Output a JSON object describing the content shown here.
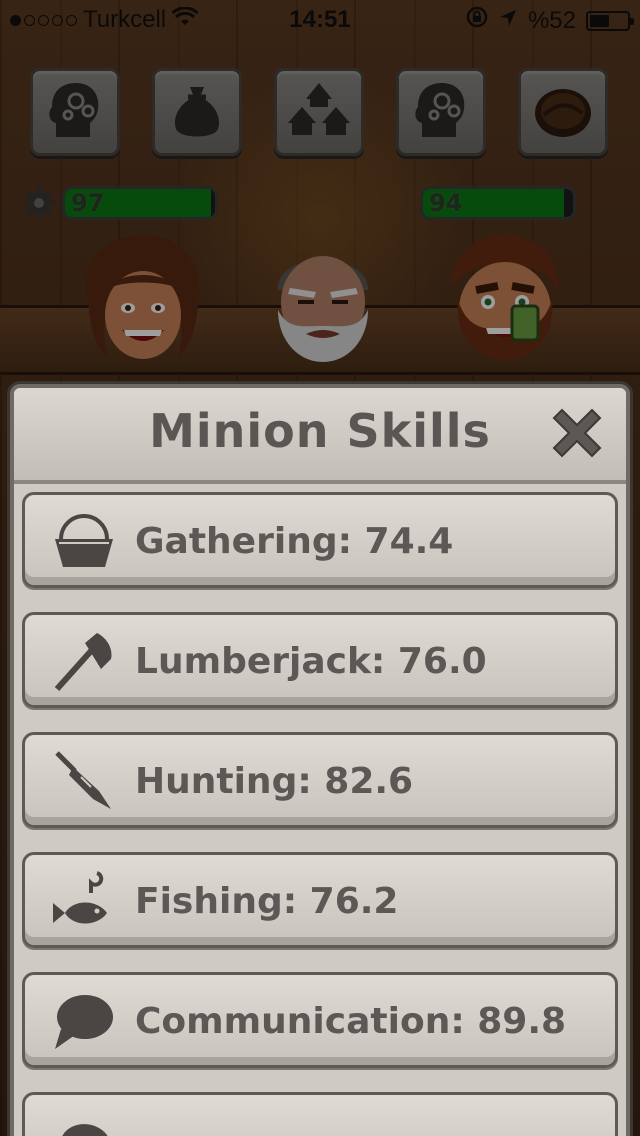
{
  "status_bar": {
    "carrier": "Turkcell",
    "time": "14:51",
    "battery_text": "%52",
    "signal_filled": 1,
    "signal_total": 5,
    "battery_level": 0.52
  },
  "top_tools": [
    {
      "name": "brain-gears-icon"
    },
    {
      "name": "sack-icon"
    },
    {
      "name": "huts-icon"
    },
    {
      "name": "brain-gears-icon"
    },
    {
      "name": "coconut-icon"
    }
  ],
  "stats": {
    "left_value": "97",
    "left_fraction": 0.97,
    "right_value": "94",
    "right_fraction": 0.94
  },
  "modal": {
    "title": "Minion Skills",
    "skills": [
      {
        "label": "Gathering: 74.4",
        "icon": "bucket-icon"
      },
      {
        "label": "Lumberjack: 76.0",
        "icon": "axe-icon"
      },
      {
        "label": "Hunting: 82.6",
        "icon": "spear-icon"
      },
      {
        "label": "Fishing: 76.2",
        "icon": "fish-icon"
      },
      {
        "label": "Communication: 89.8",
        "icon": "speech-bubble-icon"
      },
      {
        "label": "",
        "icon": "rock-icon"
      }
    ]
  },
  "colors": {
    "bar_fill": "#0b7a12",
    "panel": "#cfcac3",
    "text": "#5c5856"
  }
}
